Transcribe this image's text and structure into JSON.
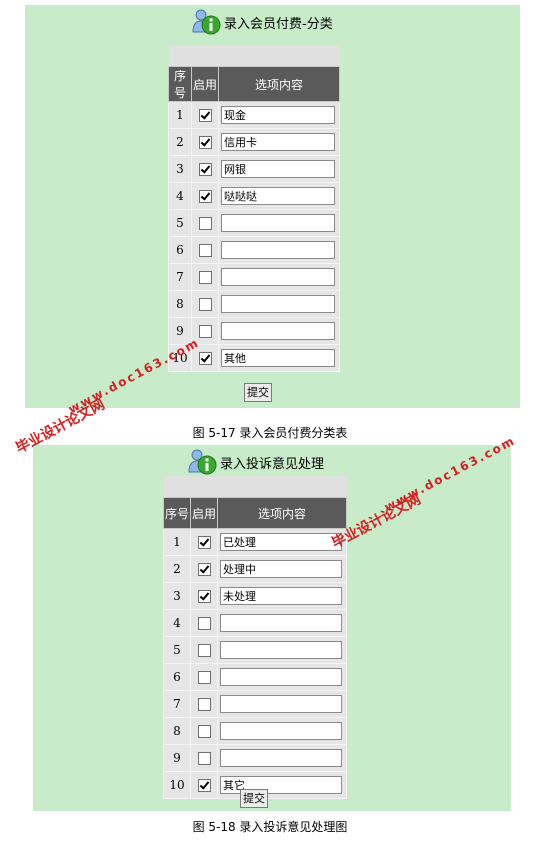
{
  "form1": {
    "title": "录入会员付费-分类",
    "headers": [
      "序号",
      "启用",
      "选项内容"
    ],
    "rows": [
      {
        "num": "1",
        "enabled": true,
        "value": "现金"
      },
      {
        "num": "2",
        "enabled": true,
        "value": "信用卡"
      },
      {
        "num": "3",
        "enabled": true,
        "value": "网银"
      },
      {
        "num": "4",
        "enabled": true,
        "value": "哒哒哒"
      },
      {
        "num": "5",
        "enabled": false,
        "value": ""
      },
      {
        "num": "6",
        "enabled": false,
        "value": ""
      },
      {
        "num": "7",
        "enabled": false,
        "value": ""
      },
      {
        "num": "8",
        "enabled": false,
        "value": ""
      },
      {
        "num": "9",
        "enabled": false,
        "value": ""
      },
      {
        "num": "10",
        "enabled": true,
        "value": "其他"
      }
    ],
    "submit_label": "提交",
    "caption": "图 5-17 录入会员付费分类表"
  },
  "form2": {
    "title": "录入投诉意见处理",
    "headers": [
      "序号",
      "启用",
      "选项内容"
    ],
    "rows": [
      {
        "num": "1",
        "enabled": true,
        "value": "已处理"
      },
      {
        "num": "2",
        "enabled": true,
        "value": "处理中"
      },
      {
        "num": "3",
        "enabled": true,
        "value": "未处理"
      },
      {
        "num": "4",
        "enabled": false,
        "value": ""
      },
      {
        "num": "5",
        "enabled": false,
        "value": ""
      },
      {
        "num": "6",
        "enabled": false,
        "value": ""
      },
      {
        "num": "7",
        "enabled": false,
        "value": ""
      },
      {
        "num": "8",
        "enabled": false,
        "value": ""
      },
      {
        "num": "9",
        "enabled": false,
        "value": ""
      },
      {
        "num": "10",
        "enabled": true,
        "value": "其它"
      }
    ],
    "submit_label": "提交",
    "caption": "图 5-18 录入投诉意见处理图"
  },
  "watermarks": [
    {
      "text": "毕业设计论文网"
    },
    {
      "text": "www.doc163.com"
    },
    {
      "text": "毕业设计论文网"
    },
    {
      "text": "www.doc163.com"
    }
  ],
  "colors": {
    "panel_bg": "#c8ebca",
    "header_bg": "#5a5a5a",
    "watermark": "#d42020",
    "info_icon": "#3aa82e"
  },
  "icons": {
    "title_icon": "user-info-icon"
  }
}
